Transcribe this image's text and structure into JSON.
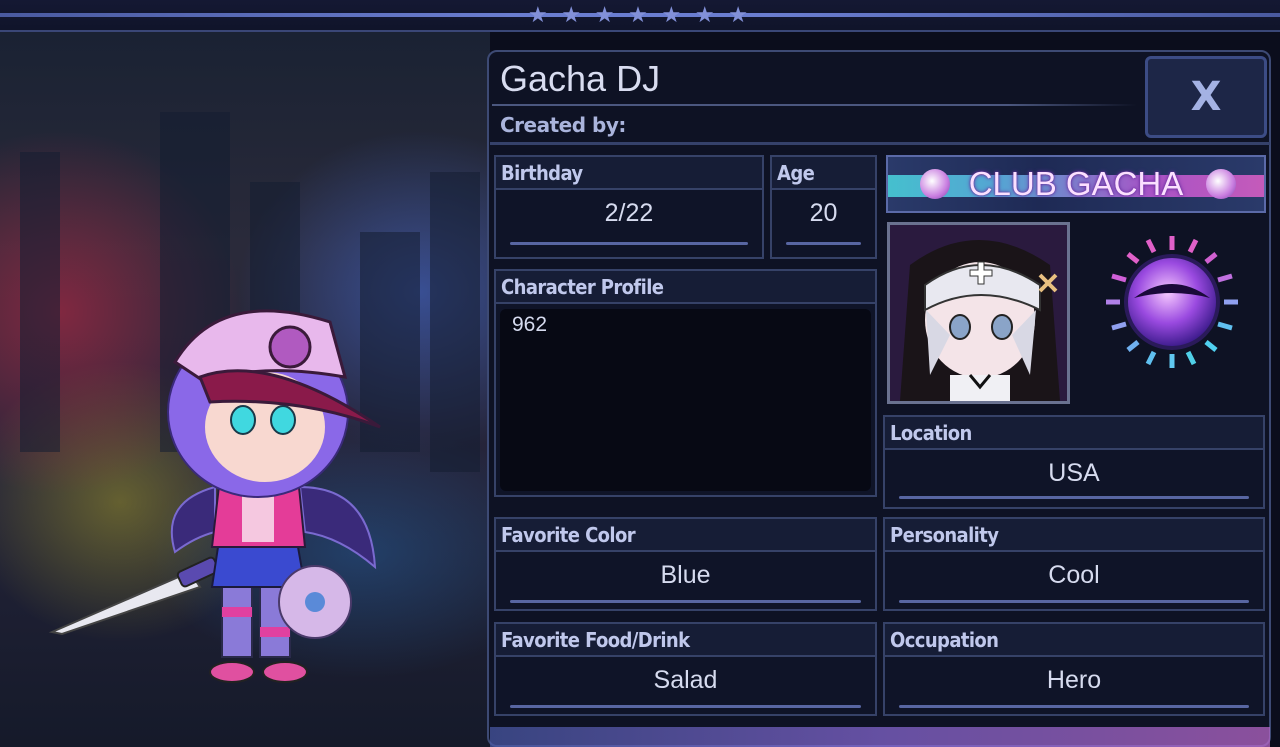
{
  "header": {
    "stars": [
      "★",
      "★",
      "★",
      "★",
      "★",
      "★",
      "★"
    ]
  },
  "profile": {
    "name": "Gacha DJ",
    "created_by_label": "Created by:",
    "close_label": "X",
    "banner_text": "CLUB GACHA",
    "fields": {
      "birthday": {
        "label": "Birthday",
        "value": "2/22"
      },
      "age": {
        "label": "Age",
        "value": "20"
      },
      "character_profile": {
        "label": "Character Profile",
        "value": "962"
      },
      "location": {
        "label": "Location",
        "value": "USA"
      },
      "favorite_color": {
        "label": "Favorite Color",
        "value": "Blue"
      },
      "personality": {
        "label": "Personality",
        "value": "Cool"
      },
      "favorite_food": {
        "label": "Favorite Food/Drink",
        "value": "Salad"
      },
      "occupation": {
        "label": "Occupation",
        "value": "Hero"
      }
    }
  },
  "colors": {
    "panel_bg": "#0e1224",
    "border": "#364268",
    "label_text": "#c0c8ec",
    "value_text": "#d6dbef",
    "accent_cyan": "#4ad7e0",
    "accent_pink": "#e060c8"
  },
  "icons": {
    "close": "close-icon",
    "logo": "club-gacha-orb-icon",
    "star": "star-icon"
  }
}
